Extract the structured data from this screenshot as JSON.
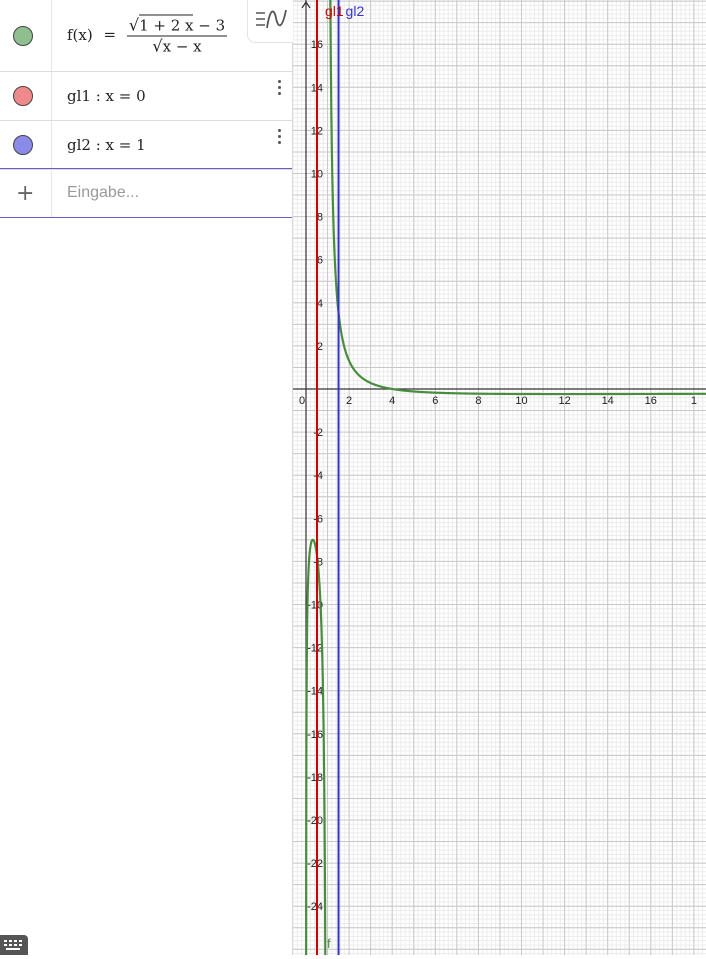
{
  "algebra": {
    "f": {
      "lhs": "f(x)",
      "eq": "=",
      "num_sqrt": "1 + 2 x",
      "num_rest": " − 3",
      "den_sqrt": "x",
      "den_rest": " − x",
      "color": "#8fbf8f"
    },
    "gl1": {
      "text": "gl1 :  x = 0",
      "color": "#f08a8a"
    },
    "gl2": {
      "text": "gl2 :  x = 1",
      "color": "#8a8ae8"
    },
    "input": {
      "placeholder": "Eingabe..."
    }
  },
  "icons": {
    "add": "plus-icon",
    "more": "more-vert-icon",
    "style": "graph-style-icon",
    "keyboard": "keyboard-icon"
  },
  "graph": {
    "x_ticks": [
      "0",
      "2",
      "4",
      "6",
      "8",
      "10",
      "12",
      "14",
      "16",
      "1"
    ],
    "y_ticks_pos": [
      "2",
      "4",
      "6",
      "8",
      "10",
      "12",
      "14",
      "16"
    ],
    "y_ticks_neg": [
      "-2",
      "-4",
      "-6",
      "-8",
      "-10",
      "-12",
      "-14",
      "-16",
      "-18",
      "-20",
      "-22",
      "-24"
    ],
    "labels": {
      "gl1": "gl1",
      "gl2": "gl2",
      "f": "f"
    },
    "colors": {
      "f": "#4a8c3f",
      "gl1": "#cc0000",
      "gl2": "#3333cc",
      "grid_major": "#c8c8c8",
      "grid_minor": "#ececec"
    }
  }
}
